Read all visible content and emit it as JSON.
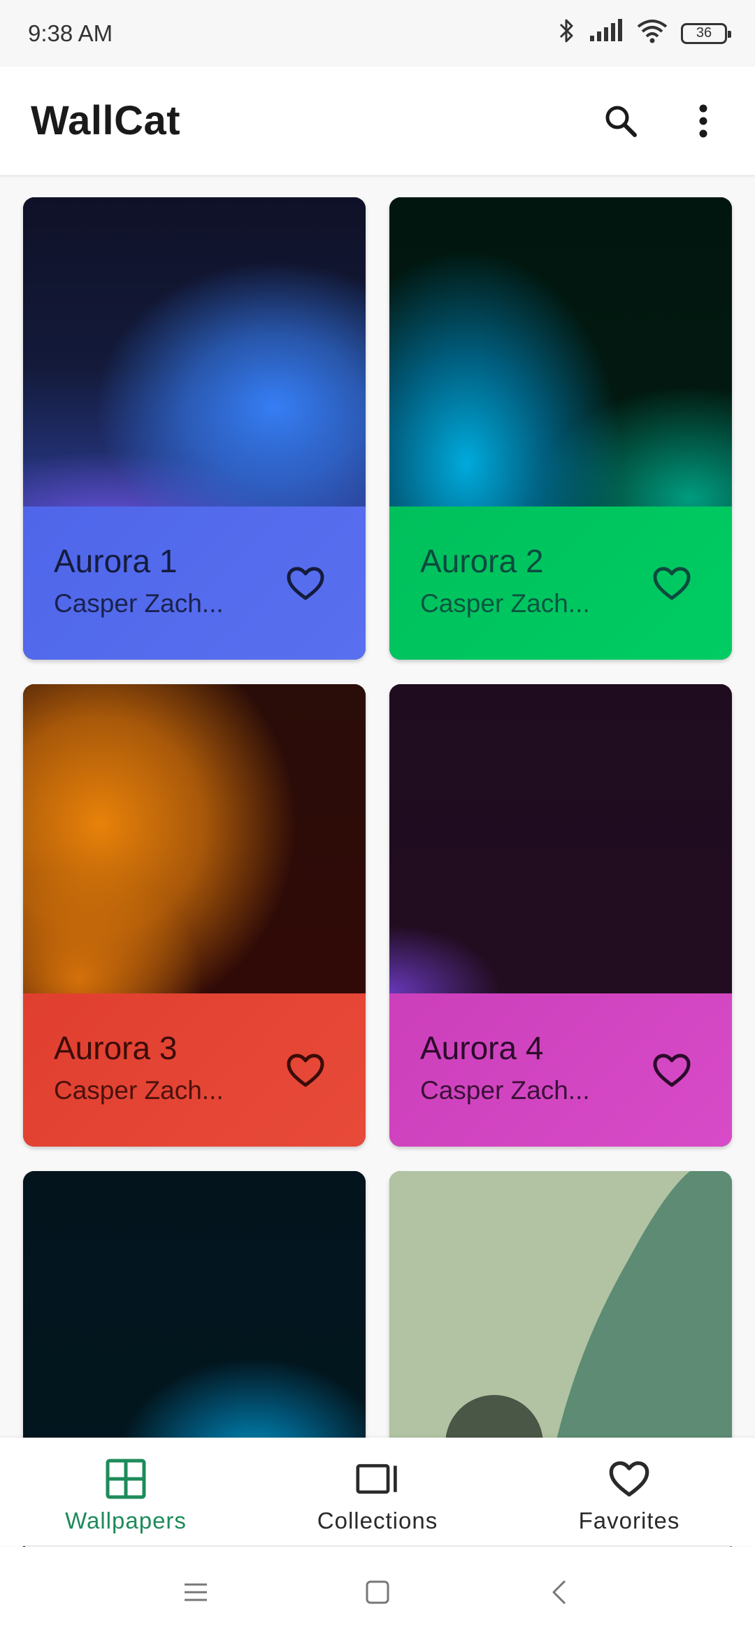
{
  "status_bar": {
    "time": "9:38 AM",
    "battery": "36",
    "icons": [
      "bluetooth-icon",
      "signal-icon",
      "wifi-icon",
      "battery-icon"
    ]
  },
  "app_bar": {
    "title": "WallCat",
    "actions": [
      "search-icon",
      "more-vert-icon"
    ]
  },
  "wallpapers": [
    {
      "title": "Aurora 1",
      "author": "Casper Zach...",
      "footer_color": "#5169EC"
    },
    {
      "title": "Aurora 2",
      "author": "Casper Zach...",
      "footer_color": "#00C55F"
    },
    {
      "title": "Aurora 3",
      "author": "Casper Zach...",
      "footer_color": "#E34434"
    },
    {
      "title": "Aurora 4",
      "author": "Casper Zach...",
      "footer_color": "#D145C1"
    }
  ],
  "bottom_nav": {
    "items": [
      {
        "label": "Wallpapers",
        "icon": "grid-icon",
        "active": true
      },
      {
        "label": "Collections",
        "icon": "collections-icon",
        "active": false
      },
      {
        "label": "Favorites",
        "icon": "heart-icon",
        "active": false
      }
    ],
    "active_color": "#1E8B5A"
  },
  "system_nav": [
    "menu-icon",
    "home-icon",
    "back-icon"
  ]
}
